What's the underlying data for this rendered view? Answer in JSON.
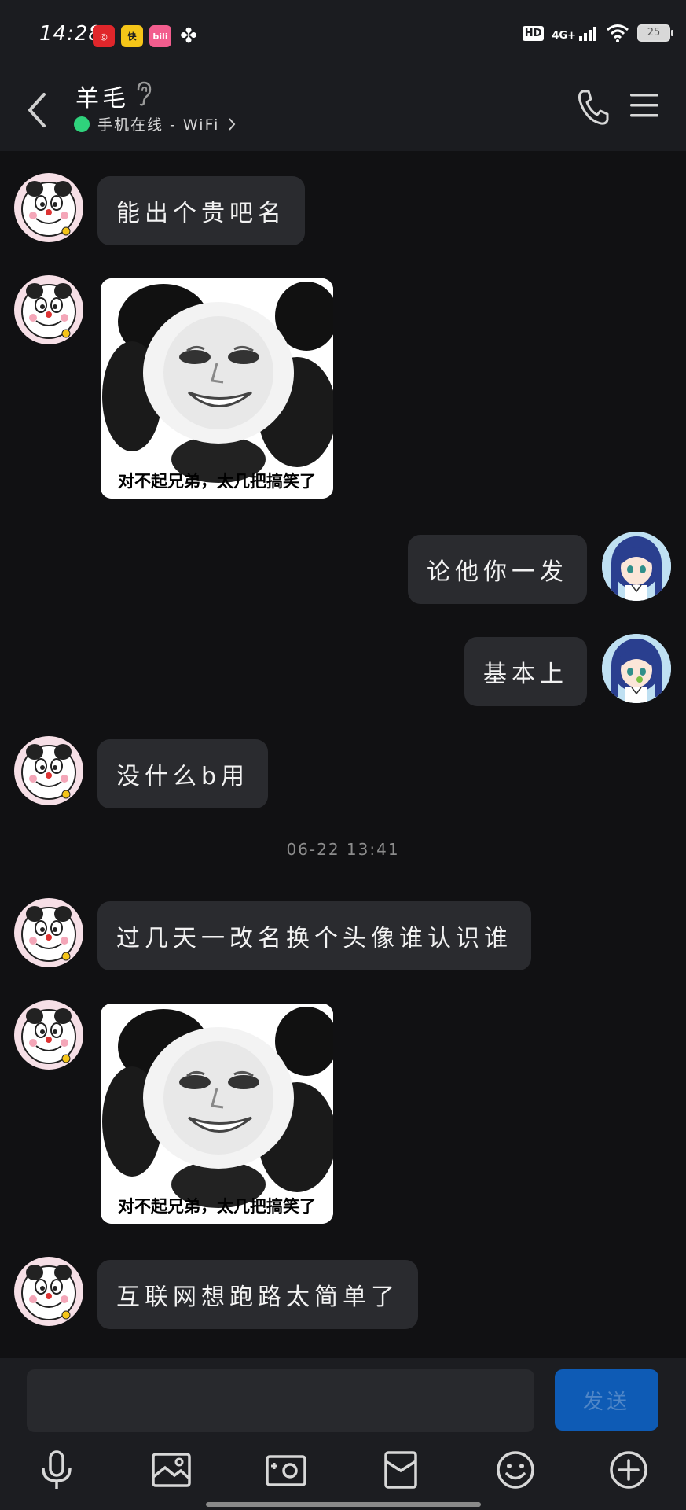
{
  "status_bar": {
    "time": "14:28",
    "apps": [
      {
        "icon": "netease-music-icon",
        "color": "#e0262b",
        "glyph": "◎"
      },
      {
        "icon": "kuaishou-icon",
        "color": "#f5c518",
        "glyph": "快"
      },
      {
        "icon": "bilibili-icon",
        "color": "#f25d8e",
        "glyph": "bili"
      },
      {
        "icon": "pinwheel-app-icon",
        "color": "#1b1c20",
        "glyph": "✤"
      }
    ],
    "hd": "HD",
    "network": "4G+",
    "battery": "25"
  },
  "header": {
    "contact_name": "羊毛",
    "online_status": "手机在线 - WiFi",
    "online_color": "#2fd27c"
  },
  "messages": [
    {
      "side": "left",
      "type": "text",
      "text": "能出个贵吧名"
    },
    {
      "side": "left",
      "type": "sticker",
      "caption": "对不起兄弟，太几把搞笑了"
    },
    {
      "side": "right",
      "type": "text",
      "text": "论他你一发"
    },
    {
      "side": "right",
      "type": "text",
      "text": "基本上"
    },
    {
      "side": "left",
      "type": "text",
      "text": "没什么b用"
    },
    {
      "type": "timestamp",
      "text": "06-22 13:41"
    },
    {
      "side": "left",
      "type": "text",
      "text": "过几天一改名换个头像谁认识谁"
    },
    {
      "side": "left",
      "type": "sticker",
      "caption": "对不起兄弟，太几把搞笑了"
    },
    {
      "side": "left",
      "type": "text",
      "text": "互联网想跑路太简单了"
    }
  ],
  "input": {
    "placeholder": "",
    "send_label": "发送",
    "send_color": "#0e5bb5"
  },
  "toolbar": [
    {
      "icon": "microphone-icon"
    },
    {
      "icon": "image-icon"
    },
    {
      "icon": "camera-icon"
    },
    {
      "icon": "red-packet-icon"
    },
    {
      "icon": "emoji-icon"
    },
    {
      "icon": "plus-icon"
    }
  ]
}
